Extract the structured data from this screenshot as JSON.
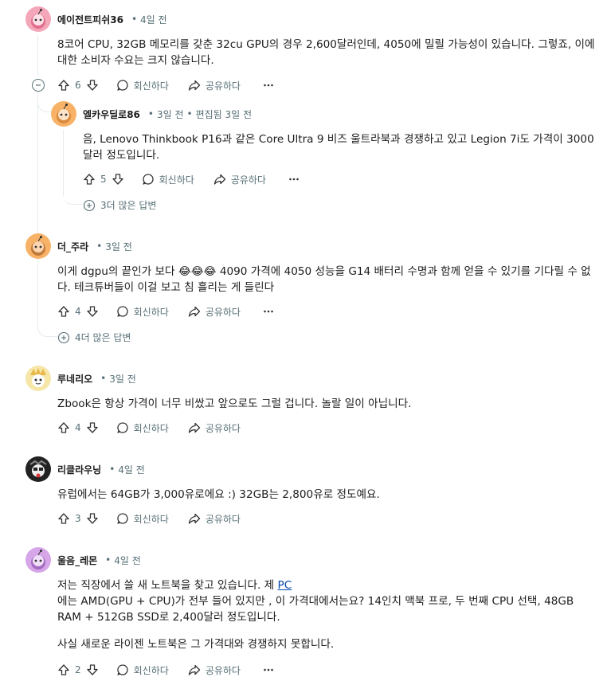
{
  "comments": [
    {
      "author": "에이전트피쉬36",
      "time": "4일 전",
      "text": "8코어 CPU, 32GB 메모리를 갖춘 32cu GPU의 경우 2,600달러인데, 4050에 밀릴 가능성이 있습니다. 그렇죠, 이에 대한 소비자 수요는 크지 않습니다.",
      "votes": "6",
      "reply_label": "회신하다",
      "share_label": "공유하다",
      "avatar_color": "#f4a7b9"
    },
    {
      "author": "엘카우딜로86",
      "time": "3일 전",
      "edited": "편집됨 3일 전",
      "text": "음, Lenovo Thinkbook P16과 같은 Core Ultra 9 비즈 울트라북과 경쟁하고 있고 Legion 7i도 가격이 3000달러 정도입니다.",
      "votes": "5",
      "reply_label": "회신하다",
      "share_label": "공유하다",
      "more_replies": "3더 많은 답변",
      "avatar_color": "#f7b267"
    },
    {
      "author": "더_주라",
      "time": "3일 전",
      "text_before": "이게 dgpu의 끝인가 보다 ",
      "emoji": "😂😂😂",
      "text_after": " 4090 가격에 4050 성능을 G14 배터리 수명과 함께 얻을 수 있기를 기다릴 수 없다. 테크튜버들이 이걸 보고 침 흘리는 게 들린다",
      "votes": "4",
      "reply_label": "회신하다",
      "share_label": "공유하다",
      "more_replies": "4더 많은 답변",
      "avatar_color": "#f7b267"
    },
    {
      "author": "루네리오",
      "time": "3일 전",
      "text": "Zbook은 항상 가격이 너무 비쌌고 앞으로도 그럴 겁니다. 놀랄 일이 아닙니다.",
      "votes": "4",
      "reply_label": "회신하다",
      "share_label": "공유하다",
      "avatar_color": "#f6e6a8"
    },
    {
      "author": "리클라우닝",
      "time": "4일 전",
      "text": "유럽에서는 64GB가 3,000유로에요 :) 32GB는 2,800유로 정도예요.",
      "votes": "3",
      "reply_label": "회신하다",
      "share_label": "공유하다",
      "avatar_color": "#222222"
    },
    {
      "author": "울음_레몬",
      "time": "4일 전",
      "text1_before": "저는 직장에서 쓸 새 노트북을 찾고 있습니다. 제 ",
      "text1_link": "PC",
      "text2": "에는 AMD(GPU + CPU)가 전부 들어 있지만 , 이 가격대에서는요? 14인치 맥북 프로, 두 번째 CPU 선택, 48GB RAM + 512GB SSD로 2,400달러 정도입니다.",
      "text3": "사실 새로운 라이젠 노트북은 그 가격대와 경쟁하지 못합니다.",
      "votes": "2",
      "reply_label": "회신하다",
      "share_label": "공유하다",
      "avatar_color": "#d6a6e8"
    }
  ],
  "more_icon": "ellipsis-icon"
}
